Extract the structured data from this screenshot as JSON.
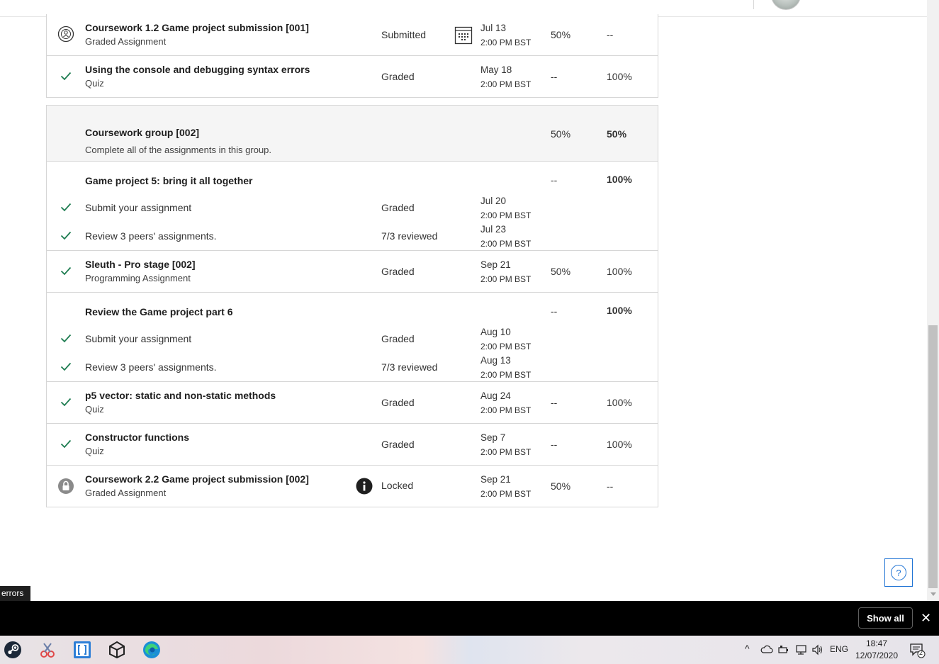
{
  "rows": [
    {
      "title": "Coursework 1.2 Game project submission [001]",
      "subtitle": "Graded Assignment",
      "status": "Submitted",
      "date": "Jul 13",
      "time": "2:00 PM BST",
      "weight": "50%",
      "grade": "--",
      "icon": "person-circle-icon"
    },
    {
      "title": "Using the console and debugging syntax errors",
      "subtitle": "Quiz",
      "status": "Graded",
      "date": "May 18",
      "time": "2:00 PM BST",
      "weight": "--",
      "grade": "100%",
      "icon": "check-icon"
    },
    {
      "title": "Coursework group [002]",
      "subtitle": "Complete all of the assignments in this group.",
      "weight": "50%",
      "grade": "50%"
    },
    {
      "title": "Game project 5: bring it all together",
      "weight": "--",
      "grade": "100%",
      "items": [
        {
          "label": "Submit your assignment",
          "status": "Graded",
          "date": "Jul 20",
          "time": "2:00 PM BST"
        },
        {
          "label": "Review 3 peers' assignments.",
          "status": "7/3 reviewed",
          "date": "Jul 23",
          "time": "2:00 PM BST"
        }
      ]
    },
    {
      "title": "Sleuth - Pro stage [002]",
      "subtitle": "Programming Assignment",
      "status": "Graded",
      "date": "Sep 21",
      "time": "2:00 PM BST",
      "weight": "50%",
      "grade": "100%"
    },
    {
      "title": "Review the Game project part 6",
      "weight": "--",
      "grade": "100%",
      "items": [
        {
          "label": "Submit your assignment",
          "status": "Graded",
          "date": "Aug 10",
          "time": "2:00 PM BST"
        },
        {
          "label": "Review 3 peers' assignments.",
          "status": "7/3 reviewed",
          "date": "Aug 13",
          "time": "2:00 PM BST"
        }
      ]
    },
    {
      "title": "p5 vector: static and non-static methods",
      "subtitle": "Quiz",
      "status": "Graded",
      "date": "Aug 24",
      "time": "2:00 PM BST",
      "weight": "--",
      "grade": "100%"
    },
    {
      "title": "Constructor functions",
      "subtitle": "Quiz",
      "status": "Graded",
      "date": "Sep 7",
      "time": "2:00 PM BST",
      "weight": "--",
      "grade": "100%"
    },
    {
      "title": "Coursework 2.2 Game project submission [002]",
      "subtitle": "Graded Assignment",
      "status": "Locked",
      "date": "Sep 21",
      "time": "2:00 PM BST",
      "weight": "50%",
      "grade": "--",
      "icon": "lock-icon"
    }
  ],
  "url_tooltip": "errors",
  "download_bar": {
    "show_all": "Show all",
    "close": "✕"
  },
  "taskbar": {
    "lang": "ENG",
    "time": "18:47",
    "date": "12/07/2020",
    "notifications": "2"
  },
  "help_label": "?",
  "colors": {
    "check": "#1d7c50",
    "link_blue": "#1f73d4",
    "border": "#d6d6d6",
    "group_bg": "#f5f5f5"
  }
}
